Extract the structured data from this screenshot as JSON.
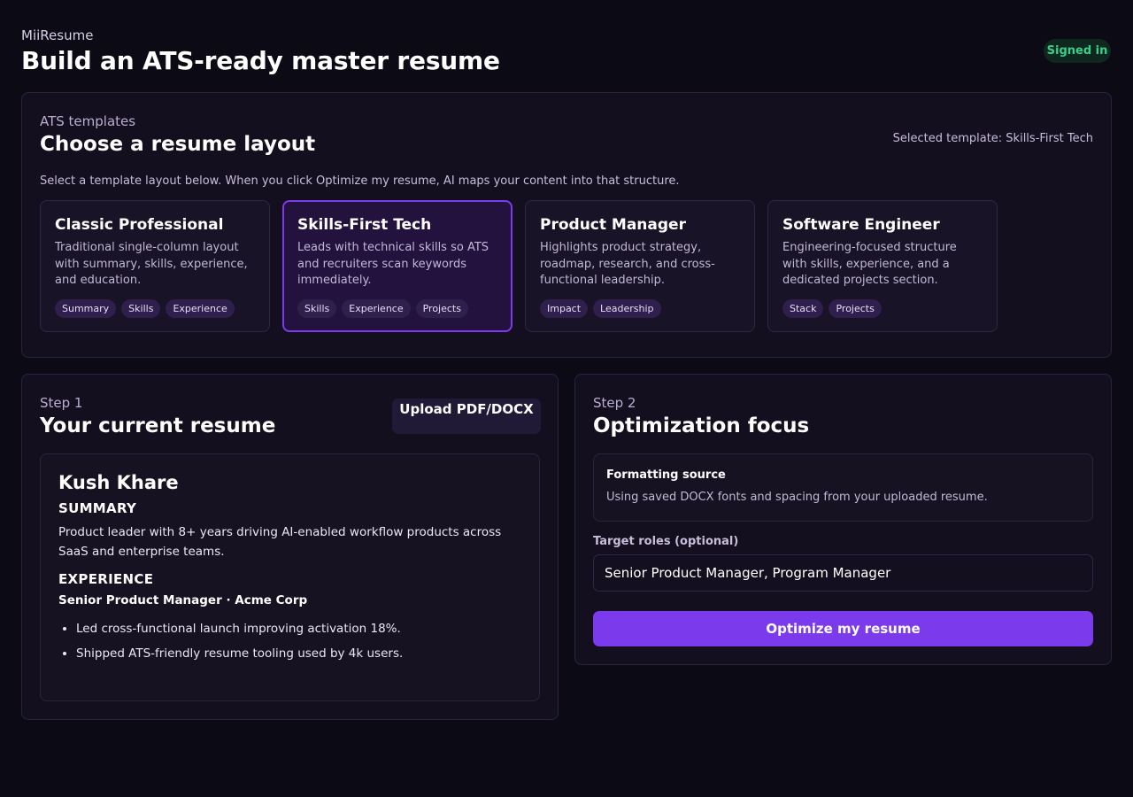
{
  "header": {
    "brand": "MiiResume",
    "title": "Build an ATS-ready master resume",
    "status_badge": "Signed in"
  },
  "templates": {
    "eyebrow": "ATS templates",
    "title": "Choose a resume layout",
    "selected_label": "Selected template: Skills-First Tech",
    "help_text": "Select a template layout below. When you click Optimize my resume, AI maps your content into that structure.",
    "cards": [
      {
        "name": "Classic Professional",
        "description": "Traditional single-column layout with summary, skills, experience, and education.",
        "tags": [
          "Summary",
          "Skills",
          "Experience"
        ],
        "selected": false
      },
      {
        "name": "Skills-First Tech",
        "description": "Leads with technical skills so ATS and recruiters scan keywords immediately.",
        "tags": [
          "Skills",
          "Experience",
          "Projects"
        ],
        "selected": true
      },
      {
        "name": "Product Manager",
        "description": "Highlights product strategy, roadmap, research, and cross-functional leadership.",
        "tags": [
          "Impact",
          "Leadership"
        ],
        "selected": false
      },
      {
        "name": "Software Engineer",
        "description": "Engineering-focused structure with skills, experience, and a dedicated projects section.",
        "tags": [
          "Stack",
          "Projects"
        ],
        "selected": false
      }
    ]
  },
  "step1": {
    "eyebrow": "Step 1",
    "title": "Your current resume",
    "upload_label": "Upload PDF/DOCX",
    "resume": {
      "name": "Kush Khare",
      "summary_heading": "SUMMARY",
      "summary": "Product leader with 8+ years driving AI-enabled workflow products across SaaS and enterprise teams.",
      "experience_heading": "EXPERIENCE",
      "role": "Senior Product Manager · Acme Corp",
      "bullets": [
        "Led cross-functional launch improving activation 18%.",
        "Shipped ATS-friendly resume tooling used by 4k users."
      ]
    }
  },
  "step2": {
    "eyebrow": "Step 2",
    "title": "Optimization focus",
    "format_title": "Formatting source",
    "format_desc": "Using saved DOCX fonts and spacing from your uploaded resume.",
    "target_label": "Target roles (optional)",
    "target_value": "Senior Product Manager, Program Manager",
    "optimize_label": "Optimize my resume"
  },
  "colors": {
    "background": "#0c0a14",
    "panel": "#130f1f",
    "accent": "#7c3aed",
    "success": "#37d08a"
  }
}
